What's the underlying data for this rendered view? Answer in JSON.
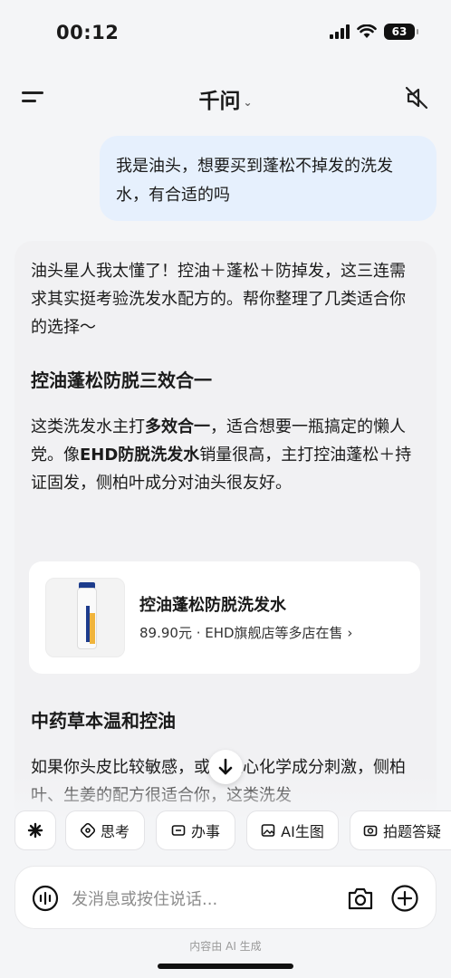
{
  "status": {
    "time": "00:12",
    "battery": "63"
  },
  "header": {
    "title": "千问",
    "caret": "⌄"
  },
  "user_message": "我是油头，想要买到蓬松不掉发的洗发水，有合适的吗",
  "ai": {
    "intro": "油头星人我太懂了！控油＋蓬松＋防掉发，这三连需求其实挺考验洗发水配方的。帮你整理了几类适合你的选择～",
    "section1_title": "控油蓬松防脱三效合一",
    "section1_p1": "这类洗发水主打",
    "section1_bold1": "多效合一",
    "section1_p2": "，适合想要一瓶搞定的懒人党。像",
    "section1_bold2": "EHD防脱洗发水",
    "section1_p3": "销量很高，主打控油蓬松＋持证固发，侧柏叶成分对油头很友好。",
    "product": {
      "name": "控油蓬松防脱洗发水",
      "meta": "89.90元 · EHD旗舰店等多店在售 ›"
    },
    "section2_title": "中药草本温和控油",
    "section2_text": "如果你头皮比较敏感，或者担心化学成分刺激，侧柏叶、生姜的配方很适合你，这类洗发"
  },
  "chips": [
    "思考",
    "办事",
    "AI生图",
    "拍题答疑"
  ],
  "input": {
    "placeholder": "发消息或按住说话..."
  },
  "footer": "内容由 AI 生成"
}
